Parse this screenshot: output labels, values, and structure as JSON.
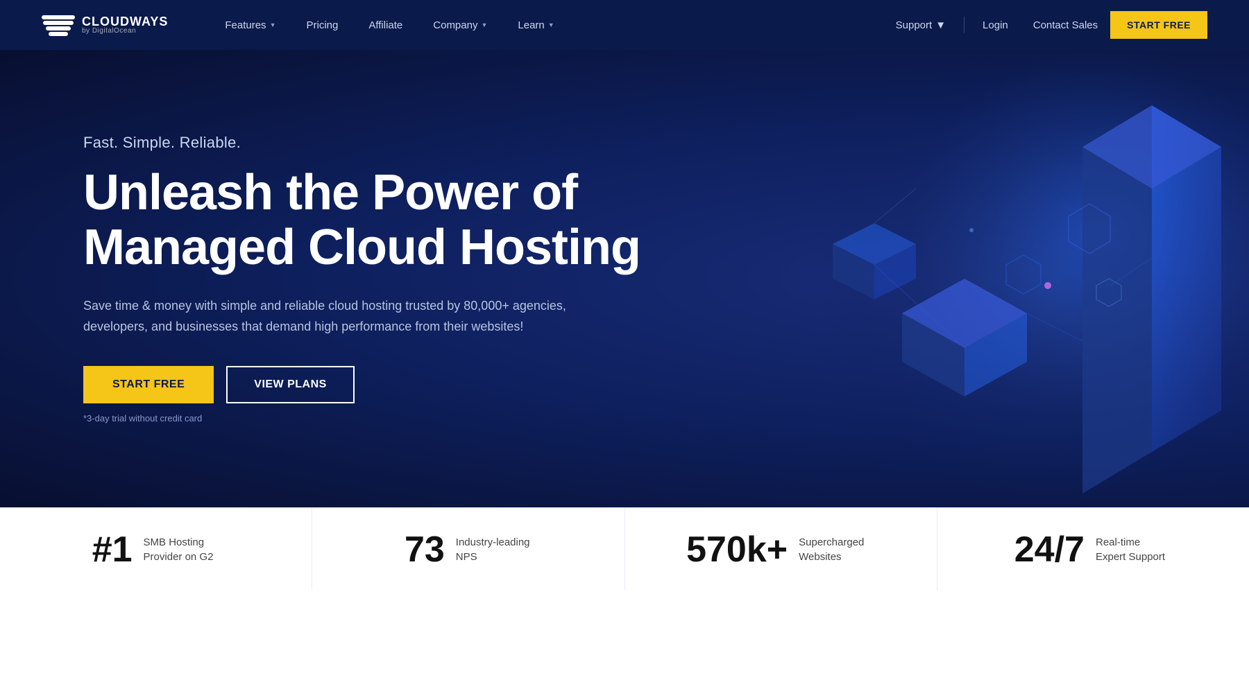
{
  "brand": {
    "name": "CLOUDWAYS",
    "sub": "by DigitalOcean",
    "logo_alt": "Cloudways logo"
  },
  "nav": {
    "features_label": "Features",
    "pricing_label": "Pricing",
    "affiliate_label": "Affiliate",
    "company_label": "Company",
    "learn_label": "Learn",
    "support_label": "Support",
    "login_label": "Login",
    "contact_label": "Contact Sales",
    "start_free_label": "START FREE"
  },
  "hero": {
    "tagline": "Fast. Simple. Reliable.",
    "title_line1": "Unleash the Power of",
    "title_line2": "Managed Cloud Hosting",
    "description": "Save time & money with simple and reliable cloud hosting trusted by 80,000+ agencies, developers, and businesses that demand high performance from their websites!",
    "btn_start": "START FREE",
    "btn_plans": "VIEW PLANS",
    "note": "*3-day trial without credit card"
  },
  "stats": [
    {
      "number": "#1",
      "label": "SMB Hosting Provider on G2"
    },
    {
      "number": "73",
      "label": "Industry-leading NPS"
    },
    {
      "number": "570k+",
      "label": "Supercharged Websites"
    },
    {
      "number": "24/7",
      "label": "Real-time Expert Support"
    }
  ]
}
